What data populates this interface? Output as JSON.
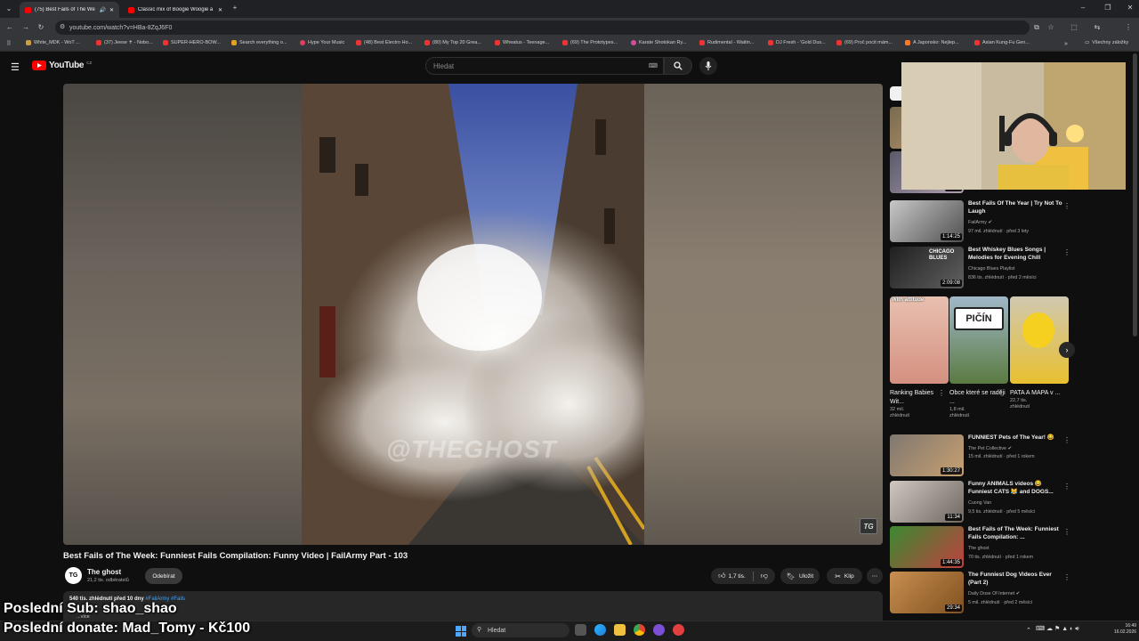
{
  "browser": {
    "tabs": [
      {
        "label": "(75) Best Fails of The Week"
      },
      {
        "label": "Classic mix of Boogie Woogie a"
      }
    ],
    "url": "youtube.com/watch?v=HBa-8ZqJ6F0",
    "bookmarks": [
      "White_MDK - WoT ...",
      "(37) Jeese ✝ - Nobo...",
      "SUPER-HERO-BOW...",
      "Search everything o...",
      "Hype Your Music",
      "(48) Best Electro Ho...",
      "(80) My Top 20 Grea...",
      "Wheatus - Teenage...",
      "(69) The Prototypes...",
      "Karate Shotokan Ry...",
      "Rudimental - Waitin...",
      "DJ Fresh - 'Gold Dus...",
      "(69) Proč pocit mám...",
      "A Japonsko: Nejlep...",
      "Asian Kung-Fu Gen..."
    ],
    "all_bookmarks": "Všechny záložky"
  },
  "youtube": {
    "logo": "YouTube",
    "logo_region": "CZ",
    "search_placeholder": "Hledat"
  },
  "video": {
    "watermark": "@THEGHOST",
    "logo_mark": "TG",
    "title": "Best Fails of The Week: Funniest Fails Compilation: Funny Video | FailArmy Part - 103",
    "channel": "The ghost",
    "channel_avatar": "TG",
    "subscribers": "21,2 tis. odběratelů",
    "subscribe_label": "Odebírat",
    "likes": "1,7 tis.",
    "save_label": "Uložit",
    "clip_label": "Klip",
    "description_meta": "540 tis. zhlédnutí  před 10 dny",
    "description_tags": "#FailArmy #Fails",
    "description_more": "...více"
  },
  "sidebar": {
    "recommendations": [
      {
        "title": "Best Fails Of The Year | Try Not To Laugh",
        "channel": "FailArmy",
        "meta": "97 mil. zhlédnutí · před 3 lety",
        "duration": "1:14:25"
      },
      {
        "title": "Best Whiskey Blues Songs | Melodies for Evening Chill",
        "channel": "Chicago Blues Playlist",
        "meta": "836 tis. zhlédnutí · před 2 měsíci",
        "duration": "2:09:08",
        "thumb_text": "CHICAGO BLUES"
      },
      {
        "title": "FUNNIEST Pets of The Year! 😂",
        "channel": "The Pet Collective",
        "meta": "15 mil. zhlédnutí · před 1 rokem",
        "duration": "1:30:27"
      },
      {
        "title": "Funny ANIMALS videos 😂 Funniest CATS 😹 and DOGS...",
        "channel": "Cuong Van",
        "meta": "9,5 tis. zhlédnutí · před 5 měsíci",
        "duration": "11:34"
      },
      {
        "title": "Best Fails of The Week: Funniest Fails Compilation: ...",
        "channel": "The ghost",
        "meta": "70 tis. zhlédnutí · před 1 rokem",
        "duration": "1:44:35"
      },
      {
        "title": "The Funniest Dog Videos Ever (Part 2)",
        "channel": "Daily Dose Of Internet",
        "meta": "5 mil. zhlédnutí · před 2 měsíci",
        "duration": "29:34"
      }
    ],
    "top_duration": "37:04",
    "shorts": [
      {
        "title": "Ranking Babies Wit...",
        "meta1": "32 mil.",
        "meta2": "zhlédnutí",
        "thumb_text": "With attitude"
      },
      {
        "title": "Obce které se raději ...",
        "meta1": "1,8 mil.",
        "meta2": "zhlédnutí",
        "thumb_text": "PIČÍN"
      },
      {
        "title": "PATA A MAPA v ...",
        "meta1": "22,7 tis.",
        "meta2": "zhlédnutí",
        "thumb_text": ""
      }
    ]
  },
  "overlay": {
    "last_sub": "Poslední Sub: shao_shao",
    "last_donate": "Poslední donate: Mad_Tomy - Kč100"
  },
  "taskbar": {
    "search": "Hledat",
    "time": "16:49",
    "date": "16.02.2026"
  }
}
